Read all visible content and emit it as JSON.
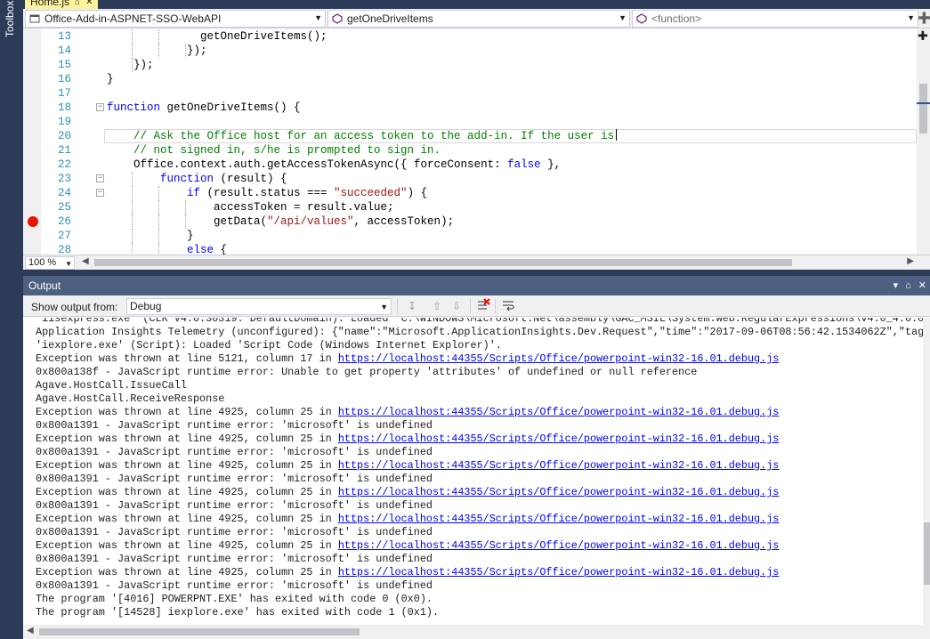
{
  "toolbox": {
    "label": "Toolbox"
  },
  "doc_tab": {
    "name": "Home.js",
    "pin_icon": "pin-icon",
    "close_icon": "close-icon"
  },
  "nav": {
    "project": "Office-Add-in-ASPNET-SSO-WebAPI",
    "type": "getOneDriveItems",
    "member": "<function>",
    "split_icon": "split-icon"
  },
  "code_lines": [
    {
      "num": "13",
      "tokens": [
        {
          "t": "getOneDriveItems();",
          "c": ""
        }
      ]
    },
    {
      "num": "14",
      "tokens": [
        {
          "t": "});",
          "c": ""
        }
      ]
    },
    {
      "num": "15",
      "tokens": [
        {
          "t": "});",
          "c": ""
        }
      ]
    },
    {
      "num": "16",
      "tokens": [
        {
          "t": "}",
          "c": ""
        }
      ]
    },
    {
      "num": "17",
      "tokens": []
    },
    {
      "num": "18",
      "tokens": [
        {
          "t": "function",
          "c": "kw"
        },
        {
          "t": " getOneDriveItems() {",
          "c": ""
        }
      ]
    },
    {
      "num": "19",
      "tokens": []
    },
    {
      "num": "20",
      "tokens": [
        {
          "t": "// Ask the Office host for an access token to the add-in. If the user is",
          "c": "cm"
        }
      ]
    },
    {
      "num": "21",
      "tokens": [
        {
          "t": "// not signed in, s/he is prompted to sign in.",
          "c": "cm"
        }
      ]
    },
    {
      "num": "22",
      "tokens": [
        {
          "t": "Office.context.auth.getAccessTokenAsync({ forceConsent: ",
          "c": ""
        },
        {
          "t": "false",
          "c": "kw"
        },
        {
          "t": " },",
          "c": ""
        }
      ]
    },
    {
      "num": "23",
      "tokens": [
        {
          "t": "function",
          "c": "kw"
        },
        {
          "t": " (result) {",
          "c": ""
        }
      ]
    },
    {
      "num": "24",
      "tokens": [
        {
          "t": "if",
          "c": "kw"
        },
        {
          "t": " (result.status === ",
          "c": ""
        },
        {
          "t": "\"succeeded\"",
          "c": "str"
        },
        {
          "t": ") {",
          "c": ""
        }
      ]
    },
    {
      "num": "25",
      "tokens": [
        {
          "t": "accessToken = result.value;",
          "c": ""
        }
      ]
    },
    {
      "num": "26",
      "tokens": [
        {
          "t": "getData(",
          "c": ""
        },
        {
          "t": "\"/api/values\"",
          "c": "str"
        },
        {
          "t": ", accessToken);",
          "c": ""
        }
      ]
    },
    {
      "num": "27",
      "tokens": [
        {
          "t": "}",
          "c": ""
        }
      ]
    },
    {
      "num": "28",
      "tokens": [
        {
          "t": "else",
          "c": "kw"
        },
        {
          "t": " {",
          "c": ""
        }
      ]
    }
  ],
  "zoom": "100 %",
  "output": {
    "title": "Output",
    "show_from_label": "Show output from:",
    "source": "Debug",
    "lines": [
      {
        "text": "'iisexpress.exe' (CLR v4.0.30319: DefaultDomain): Loaded 'C:\\WINDOWS\\Microsoft.Net\\assembly\\GAC_MSIL\\System.Web.RegularExpressions\\v4.0_4.0.0.",
        "link": "",
        "rest": ""
      },
      {
        "text": "Application Insights Telemetry (unconfigured): {\"name\":\"Microsoft.ApplicationInsights.Dev.Request\",\"time\":\"2017-09-06T08:56:42.1534062Z\",\"tags",
        "link": "",
        "rest": ""
      },
      {
        "text": "'iexplore.exe' (Script): Loaded 'Script Code (Windows Internet Explorer)'.",
        "link": "",
        "rest": ""
      },
      {
        "text": "Exception was thrown at line 5121, column 17 in ",
        "link": "https://localhost:44355/Scripts/Office/powerpoint-win32-16.01.debug.js",
        "rest": ""
      },
      {
        "text": "0x800a138f - JavaScript runtime error: Unable to get property 'attributes' of undefined or null reference",
        "link": "",
        "rest": ""
      },
      {
        "text": "Agave.HostCall.IssueCall",
        "link": "",
        "rest": ""
      },
      {
        "text": "Agave.HostCall.ReceiveResponse",
        "link": "",
        "rest": ""
      },
      {
        "text": "Exception was thrown at line 4925, column 25 in ",
        "link": "https://localhost:44355/Scripts/Office/powerpoint-win32-16.01.debug.js",
        "rest": ""
      },
      {
        "text": "0x800a1391 - JavaScript runtime error: 'microsoft' is undefined",
        "link": "",
        "rest": ""
      },
      {
        "text": "Exception was thrown at line 4925, column 25 in ",
        "link": "https://localhost:44355/Scripts/Office/powerpoint-win32-16.01.debug.js",
        "rest": ""
      },
      {
        "text": "0x800a1391 - JavaScript runtime error: 'microsoft' is undefined",
        "link": "",
        "rest": ""
      },
      {
        "text": "Exception was thrown at line 4925, column 25 in ",
        "link": "https://localhost:44355/Scripts/Office/powerpoint-win32-16.01.debug.js",
        "rest": ""
      },
      {
        "text": "0x800a1391 - JavaScript runtime error: 'microsoft' is undefined",
        "link": "",
        "rest": ""
      },
      {
        "text": "Exception was thrown at line 4925, column 25 in ",
        "link": "https://localhost:44355/Scripts/Office/powerpoint-win32-16.01.debug.js",
        "rest": ""
      },
      {
        "text": "0x800a1391 - JavaScript runtime error: 'microsoft' is undefined",
        "link": "",
        "rest": ""
      },
      {
        "text": "Exception was thrown at line 4925, column 25 in ",
        "link": "https://localhost:44355/Scripts/Office/powerpoint-win32-16.01.debug.js",
        "rest": ""
      },
      {
        "text": "0x800a1391 - JavaScript runtime error: 'microsoft' is undefined",
        "link": "",
        "rest": ""
      },
      {
        "text": "Exception was thrown at line 4925, column 25 in ",
        "link": "https://localhost:44355/Scripts/Office/powerpoint-win32-16.01.debug.js",
        "rest": ""
      },
      {
        "text": "0x800a1391 - JavaScript runtime error: 'microsoft' is undefined",
        "link": "",
        "rest": ""
      },
      {
        "text": "Exception was thrown at line 4925, column 25 in ",
        "link": "https://localhost:44355/Scripts/Office/powerpoint-win32-16.01.debug.js",
        "rest": ""
      },
      {
        "text": "0x800a1391 - JavaScript runtime error: 'microsoft' is undefined",
        "link": "",
        "rest": ""
      },
      {
        "text": "The program '[4016] POWERPNT.EXE' has exited with code 0 (0x0).",
        "link": "",
        "rest": ""
      },
      {
        "text": "The program '[14528] iexplore.exe' has exited with code 1 (0x1).",
        "link": "",
        "rest": ""
      }
    ]
  },
  "colors": {
    "chrome": "#2b3b58",
    "tab_active": "#fff29d",
    "output_title": "#4d6082",
    "breakpoint": "#e51400",
    "keyword": "#0000ff",
    "string": "#a31515",
    "comment": "#008000",
    "line_number": "#2b91af"
  }
}
